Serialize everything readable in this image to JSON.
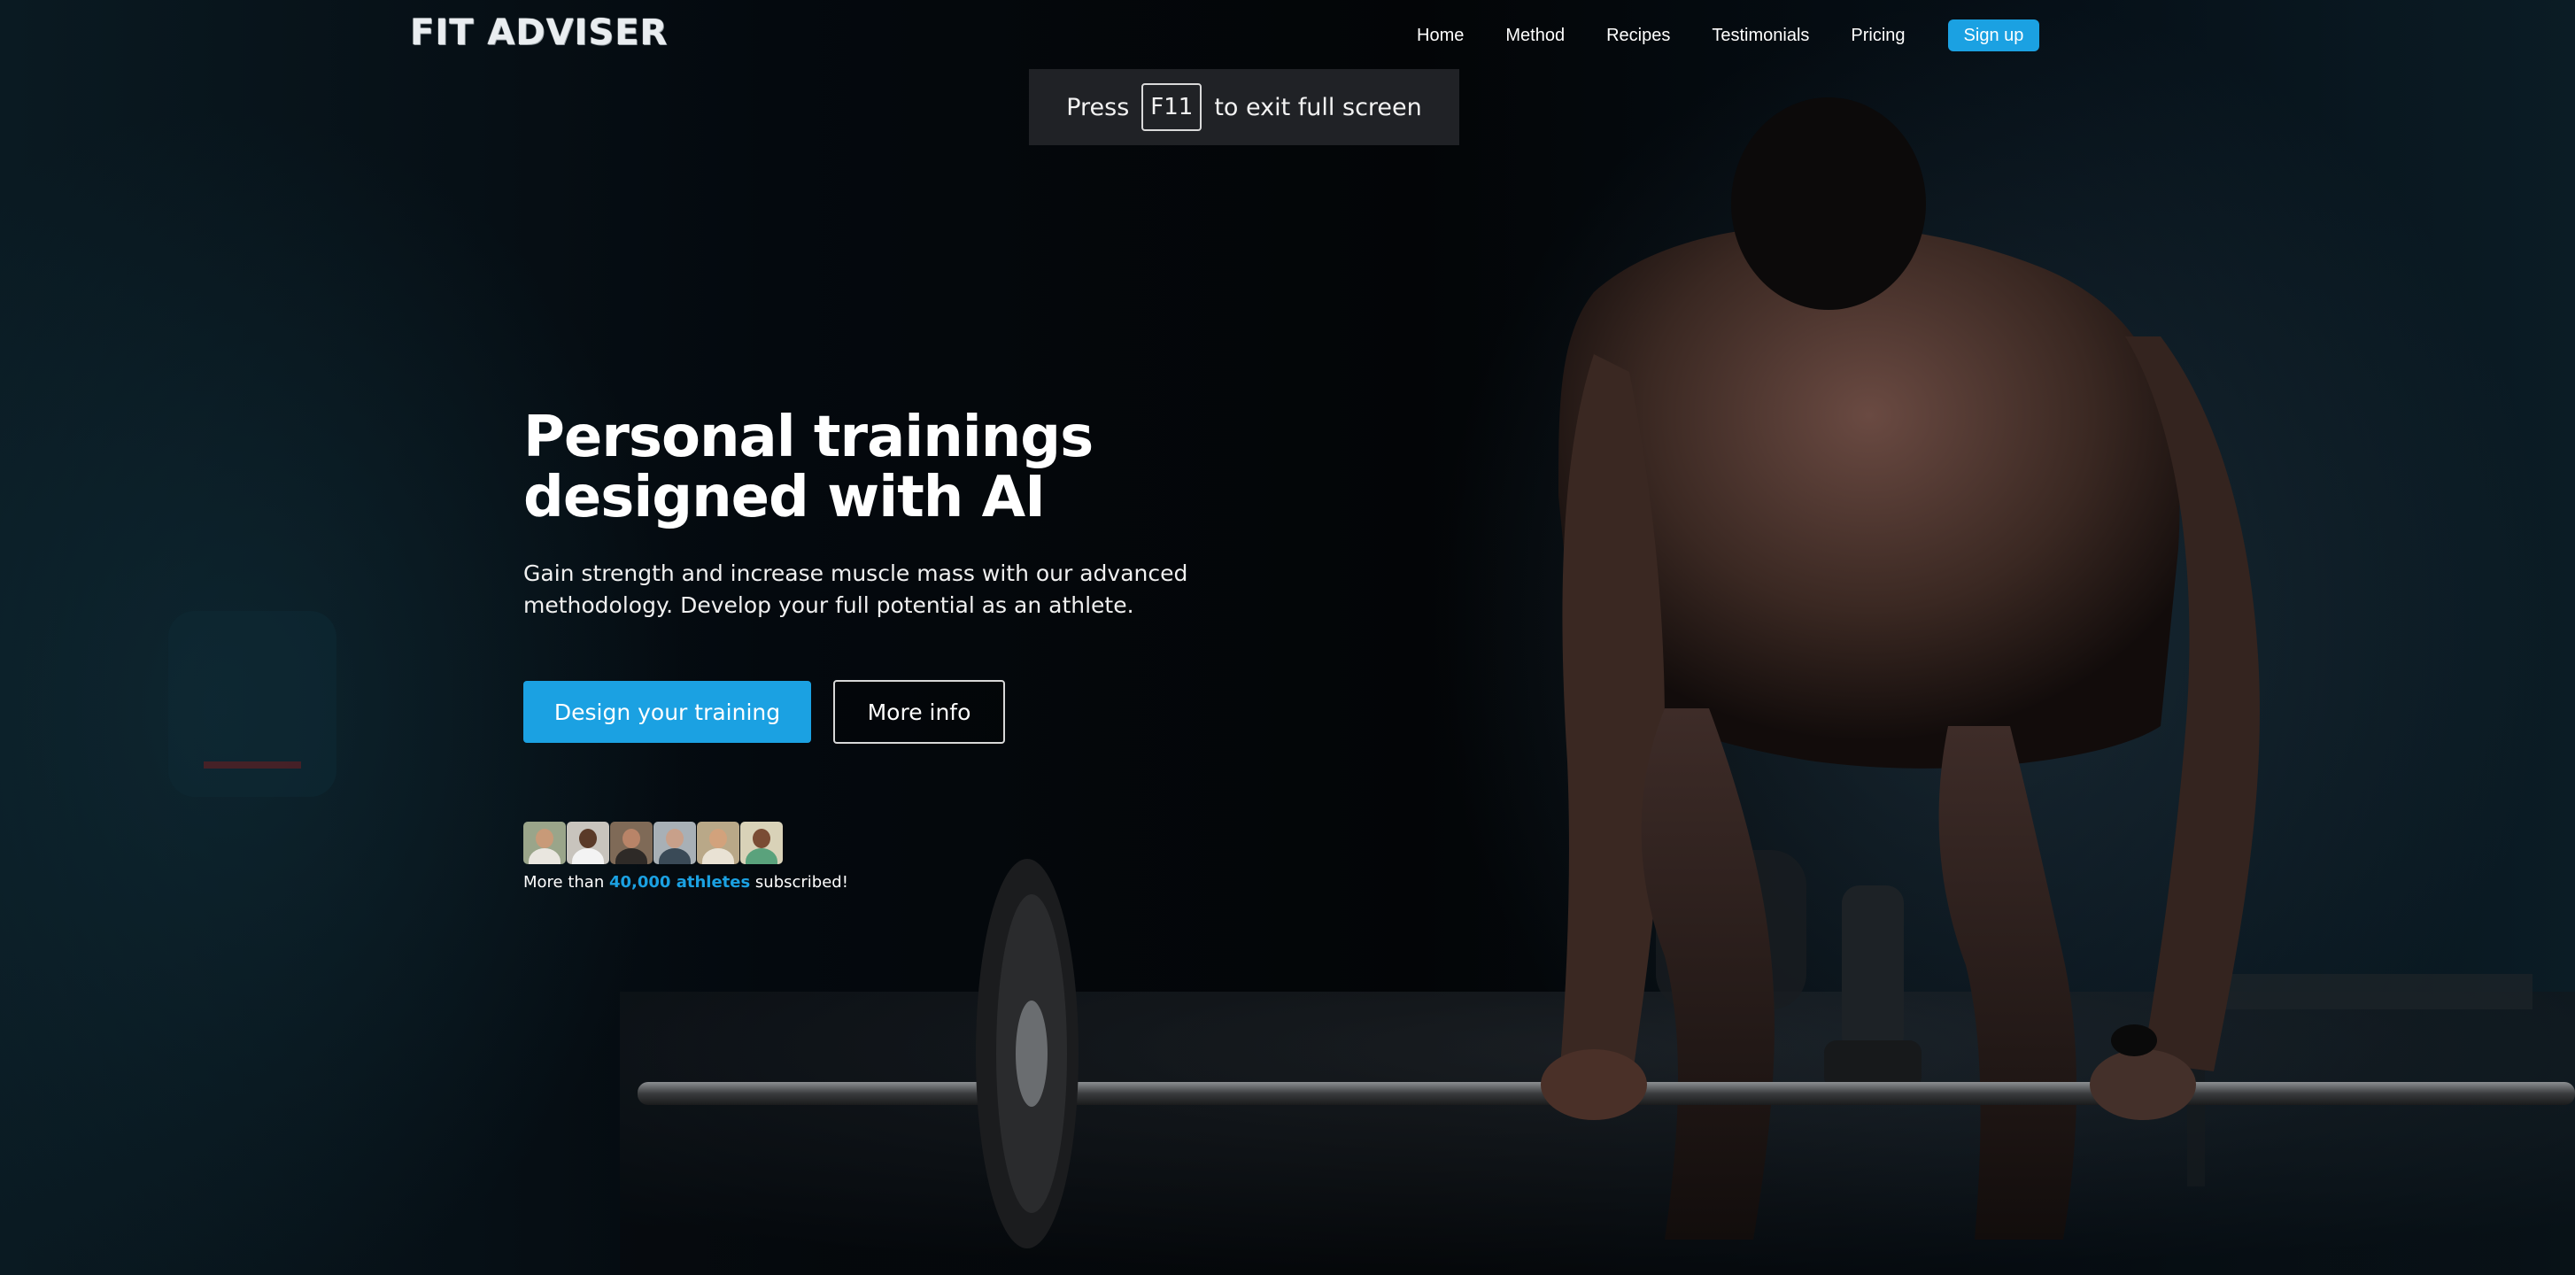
{
  "brand": {
    "logo": "FIT ADVISER"
  },
  "nav": {
    "links": [
      "Home",
      "Method",
      "Recipes",
      "Testimonials",
      "Pricing"
    ],
    "signup_label": "Sign up"
  },
  "toast": {
    "before": "Press",
    "key": "F11",
    "after": "to exit full screen"
  },
  "hero": {
    "headline_line1": "Personal trainings",
    "headline_line2": "designed with AI",
    "subtext_line1": "Gain strength and increase muscle mass with our advanced",
    "subtext_line2": "methodology. Develop your full potential as an athlete.",
    "primary_cta": "Design your training",
    "secondary_cta": "More info"
  },
  "social_proof": {
    "prefix": "More than ",
    "highlight": "40,000 athletes",
    "suffix": " subscribed!",
    "avatars": [
      {
        "bg": "#9aa58a",
        "skin": "#c89a78",
        "shirt": "#e9e6df"
      },
      {
        "bg": "#c8c4bd",
        "skin": "#5a3a28",
        "shirt": "#f3f3f3"
      },
      {
        "bg": "#7f6a57",
        "skin": "#b98468",
        "shirt": "#2e2a27"
      },
      {
        "bg": "#a8b0b6",
        "skin": "#c8a08a",
        "shirt": "#3a4a57"
      },
      {
        "bg": "#b9a888",
        "skin": "#d2a27c",
        "shirt": "#e9e2d4"
      },
      {
        "bg": "#d9d2b8",
        "skin": "#7a4c34",
        "shirt": "#5aa27c"
      }
    ]
  },
  "colors": {
    "accent": "#1ba1e2",
    "background": "#04090e"
  }
}
